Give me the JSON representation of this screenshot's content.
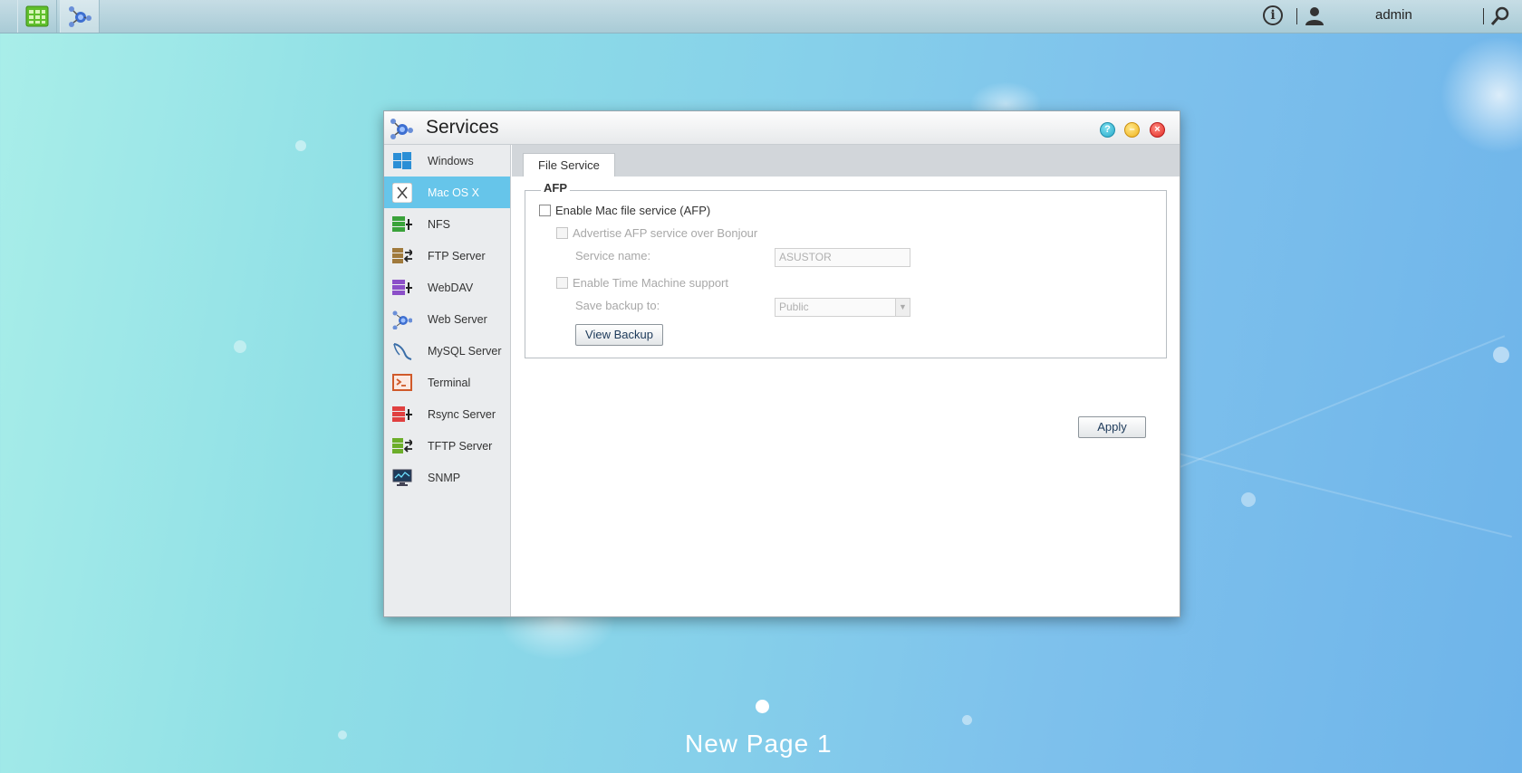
{
  "taskbar": {
    "user": "admin"
  },
  "window": {
    "title": "Services"
  },
  "sidebar": {
    "items": [
      {
        "label": "Windows",
        "icon": "windows-icon"
      },
      {
        "label": "Mac OS X",
        "icon": "mac-os-x-icon"
      },
      {
        "label": "NFS",
        "icon": "nfs-icon"
      },
      {
        "label": "FTP Server",
        "icon": "ftp-server-icon"
      },
      {
        "label": "WebDAV",
        "icon": "webdav-icon"
      },
      {
        "label": "Web Server",
        "icon": "web-server-icon"
      },
      {
        "label": "MySQL Server",
        "icon": "mysql-server-icon"
      },
      {
        "label": "Terminal",
        "icon": "terminal-icon"
      },
      {
        "label": "Rsync Server",
        "icon": "rsync-server-icon"
      },
      {
        "label": "TFTP Server",
        "icon": "tftp-server-icon"
      },
      {
        "label": "SNMP",
        "icon": "snmp-icon"
      }
    ],
    "active_index": 1
  },
  "content": {
    "tab": "File Service",
    "afp": {
      "legend": "AFP",
      "enable_label": "Enable Mac file service (AFP)",
      "bonjour_label": "Advertise AFP service over Bonjour",
      "service_name_label": "Service name:",
      "service_name_value": "ASUSTOR",
      "time_machine_label": "Enable Time Machine support",
      "save_backup_label": "Save backup to:",
      "save_backup_value": "Public",
      "view_backup_button": "View Backup"
    },
    "apply_button": "Apply"
  },
  "desktop": {
    "page_label": "New Page 1"
  },
  "colors": {
    "active_item": "#66c5ea",
    "desktop_start": "#a9eee9",
    "desktop_end": "#6eb4ea"
  }
}
